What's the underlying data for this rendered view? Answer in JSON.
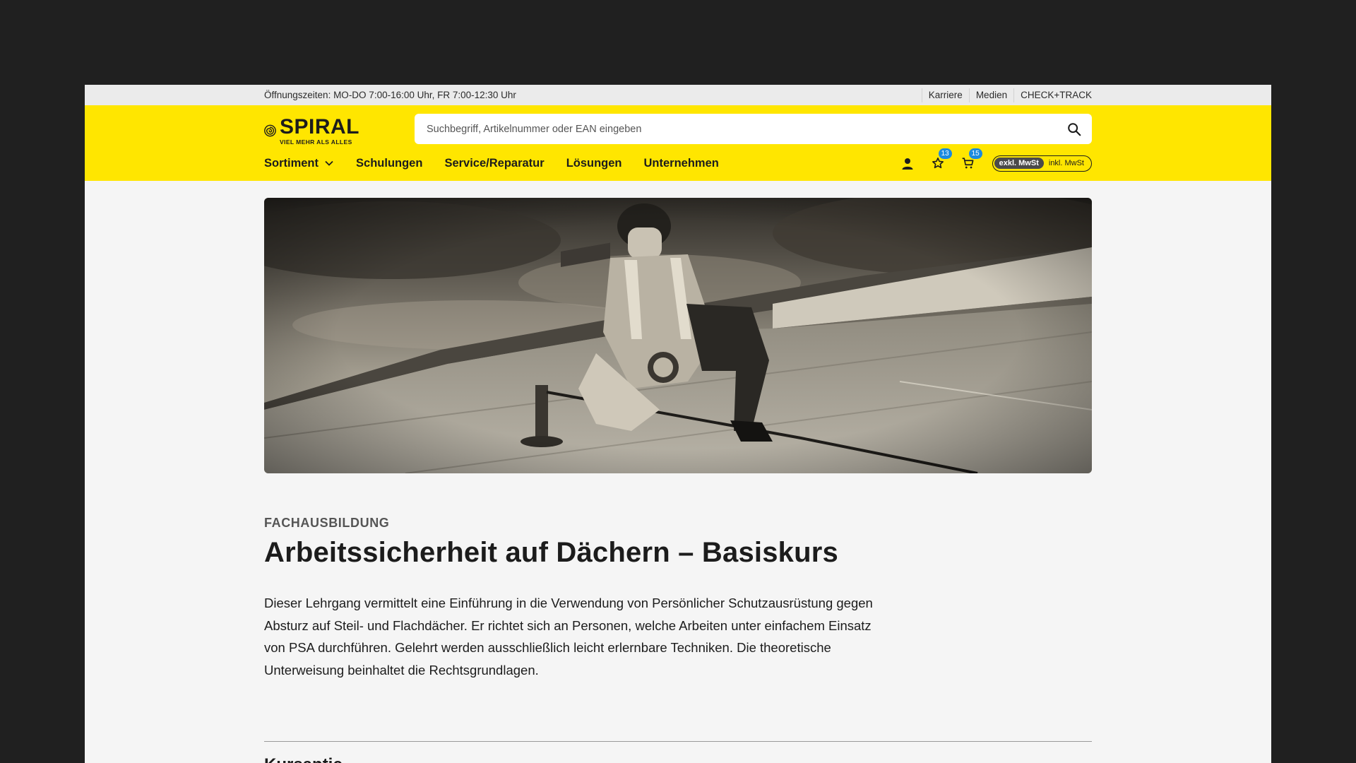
{
  "topbar": {
    "hours": "Öffnungszeiten: MO-DO 7:00-16:00 Uhr, FR 7:00-12:30 Uhr",
    "links": [
      "Karriere",
      "Medien",
      "CHECK+TRACK"
    ]
  },
  "logo": {
    "name": "SPIRAL",
    "tagline": "VIEL MEHR ALS ALLES"
  },
  "search": {
    "placeholder": "Suchbegriff, Artikelnummer oder EAN eingeben",
    "value": ""
  },
  "nav": [
    "Sortiment",
    "Schulungen",
    "Service/Reparatur",
    "Lösungen",
    "Unternehmen"
  ],
  "actions": {
    "wishlist_count": "13",
    "cart_count": "15",
    "tax_active": "exkl. MwSt",
    "tax_inactive": "inkl. MwSt"
  },
  "course": {
    "category": "FACHAUSBILDUNG",
    "title": "Arbeitssicherheit auf Dächern – Basiskurs",
    "description": "Dieser Lehrgang vermittelt eine Einführung in die Verwendung von Persönlicher Schutzausrüstung gegen Absturz auf Steil- und Flachdächer. Er richtet sich an Personen, welche Arbeiten unter einfachem Einsatz von PSA durchführen. Gelehrt werden ausschließlich leicht erlernbare Techniken. Die theoretische Unterweisung beinhaltet die Rechtsgrundlagen.",
    "next_section": "Kursantic..."
  },
  "colors": {
    "brand_yellow": "#ffe600",
    "badge_blue": "#1b8ae0",
    "page_bg": "#f5f5f5"
  },
  "icons": [
    "search-icon",
    "chevron-down-icon",
    "user-icon",
    "star-icon",
    "cart-icon"
  ]
}
